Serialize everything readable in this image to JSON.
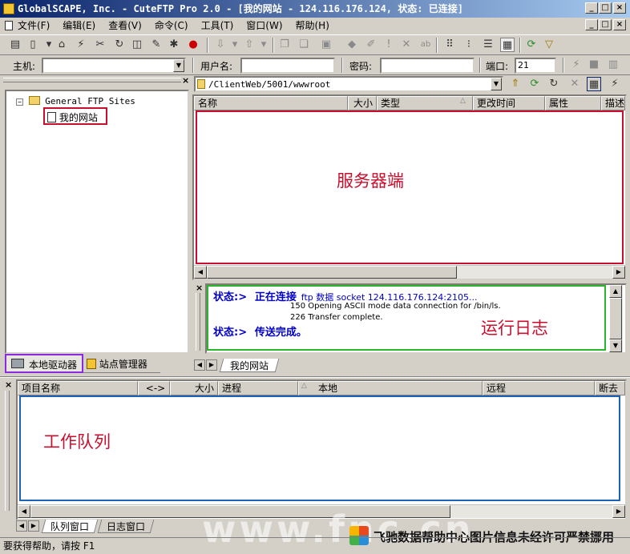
{
  "window": {
    "title": "GlobalSCAPE, Inc. - CuteFTP Pro 2.0 - [我的网站 - 124.116.176.124, 状态: 已连接]",
    "min": "_",
    "max": "□",
    "close": "×"
  },
  "menu": {
    "items": [
      "文件(F)",
      "编辑(E)",
      "查看(V)",
      "命令(C)",
      "工具(T)",
      "窗口(W)",
      "帮助(H)"
    ]
  },
  "address": {
    "host_label": "主机:",
    "host_value": "",
    "user_label": "用户名:",
    "user_value": "",
    "pass_label": "密码:",
    "pass_value": "",
    "port_label": "端口:",
    "port_value": "21"
  },
  "local": {
    "tree_root": "General FTP Sites",
    "tree_child": "我的网站",
    "tabs": [
      "本地驱动器",
      "站点管理器"
    ]
  },
  "remote": {
    "path": "/ClientWeb/5001/wwwroot",
    "columns": [
      "名称",
      "大小",
      "类型",
      "更改时间",
      "属性",
      "描述"
    ],
    "annotation": "服务器端",
    "tab": "我的网站"
  },
  "log": {
    "line1_label": "状态:>",
    "line1_status": "正在连接",
    "line1_rest": "ftp 数据 socket 124.116.176.124:2105...",
    "line2": "150 Opening ASCII mode data connection for /bin/ls.",
    "line3": "226 Transfer complete.",
    "line4_label": "状态:>",
    "line4_status": "传送完成。",
    "annotation": "运行日志"
  },
  "queue": {
    "columns": [
      "项目名称",
      "<->",
      "大小",
      "进程",
      "本地",
      "远程",
      "断去"
    ],
    "annotation": "工作队列",
    "tabs": [
      "队列窗口",
      "日志窗口"
    ]
  },
  "status": {
    "text": "要获得帮助，请按 F1"
  },
  "watermark": {
    "site": "www.fnc.cn",
    "notice": "飞驰数据帮助中心图片信息未经许可严禁挪用"
  },
  "colors": {
    "annotation_red": "#c8102e",
    "log_green": "#2bb52b",
    "queue_blue": "#1c62b9",
    "drive_purple": "#8a2be2",
    "log_text_blue": "#0000c8"
  }
}
